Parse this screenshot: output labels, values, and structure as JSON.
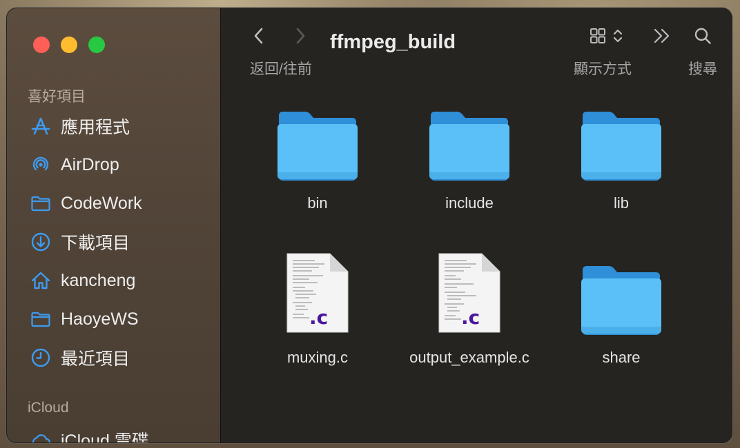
{
  "window": {
    "title": "ffmpeg_build"
  },
  "toolbar": {
    "back_forward_label": "返回/往前",
    "view_label": "顯示方式",
    "search_label": "搜尋"
  },
  "sidebar": {
    "favorites_title": "喜好項目",
    "items": [
      {
        "label": "應用程式",
        "icon": "applications-icon"
      },
      {
        "label": "AirDrop",
        "icon": "airdrop-icon"
      },
      {
        "label": "CodeWork",
        "icon": "folder-icon"
      },
      {
        "label": "下載項目",
        "icon": "downloads-icon"
      },
      {
        "label": "kancheng",
        "icon": "home-icon"
      },
      {
        "label": "HaoyeWS",
        "icon": "folder-icon"
      },
      {
        "label": "最近項目",
        "icon": "recents-icon"
      }
    ],
    "icloud_title": "iCloud",
    "icloud_items": [
      {
        "label": "iCloud 雲碟",
        "icon": "icloud-icon"
      }
    ]
  },
  "files": [
    {
      "name": "bin",
      "type": "folder"
    },
    {
      "name": "include",
      "type": "folder"
    },
    {
      "name": "lib",
      "type": "folder"
    },
    {
      "name": "muxing.c",
      "type": "c-source",
      "badge": ".c"
    },
    {
      "name": "output_example.c",
      "type": "c-source",
      "badge": ".c"
    },
    {
      "name": "share",
      "type": "folder"
    }
  ],
  "colors": {
    "accent": "#3d9bf0",
    "folder": "#5ac0f7",
    "c_badge": "#4b169e"
  }
}
